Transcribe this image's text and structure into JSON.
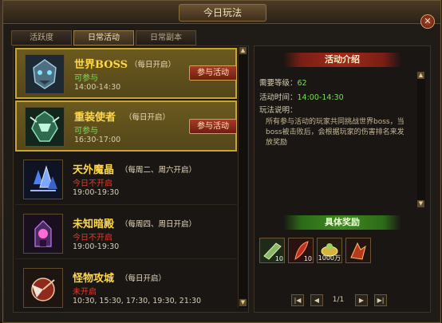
{
  "window": {
    "title": "今日玩法",
    "close": "✕"
  },
  "tabs": [
    {
      "label": "活跃度"
    },
    {
      "label": "日常活动"
    },
    {
      "label": "日常副本"
    }
  ],
  "activities": [
    {
      "name": "世界BOSS",
      "schedule": "（每日开启）",
      "status": "可参与",
      "status_color": "#7fdc5a",
      "time": "14:00-14:30",
      "button": "参与活动",
      "icon": "boss-mask-icon"
    },
    {
      "name": "重装使者",
      "schedule": "（每日开启）",
      "status": "可参与",
      "status_color": "#7fdc5a",
      "time": "16:30-17:00",
      "button": "参与活动",
      "icon": "armored-envoy-icon"
    },
    {
      "name": "天外魔晶",
      "schedule": "（每周二、周六开启）",
      "status": "今日不开启",
      "status_color": "#e23b2b",
      "time": "19:00-19:30",
      "icon": "blue-crystal-icon"
    },
    {
      "name": "未知暗殿",
      "schedule": "（每周四、周日开启）",
      "status": "今日不开启",
      "status_color": "#e23b2b",
      "time": "19:00-19:30",
      "icon": "dark-shrine-icon"
    },
    {
      "name": "怪物攻城",
      "schedule": "（每日开启）",
      "status": "未开启",
      "status_color": "#e23b2b",
      "time": "10:30, 15:30, 17:30, 19:30, 21:30",
      "icon": "siege-icon"
    }
  ],
  "detail": {
    "intro_title": "活动介绍",
    "level_label": "需要等级：",
    "level_value": "62",
    "time_label": "活动时间：",
    "time_value": "14:00-14:30",
    "rules_label": "玩法说明：",
    "rules_text": "所有参与活动的玩家共同挑战世界boss，当boss被击败后，会根据玩家的伤害排名来发放奖励",
    "reward_title": "具体奖励"
  },
  "rewards": [
    {
      "icon": "green-scroll-icon",
      "count": "10"
    },
    {
      "icon": "red-feather-icon",
      "count": "10"
    },
    {
      "icon": "gold-ingot-icon",
      "count": "1000万"
    },
    {
      "icon": "fire-rune-icon",
      "count": ""
    }
  ],
  "pager": {
    "first": "|◀",
    "prev": "◀",
    "page": "1/1",
    "next": "▶",
    "last": "▶|"
  },
  "colors": {
    "accent_gold": "#ffd84a",
    "green": "#7fdc5a",
    "red": "#e23b2b"
  }
}
